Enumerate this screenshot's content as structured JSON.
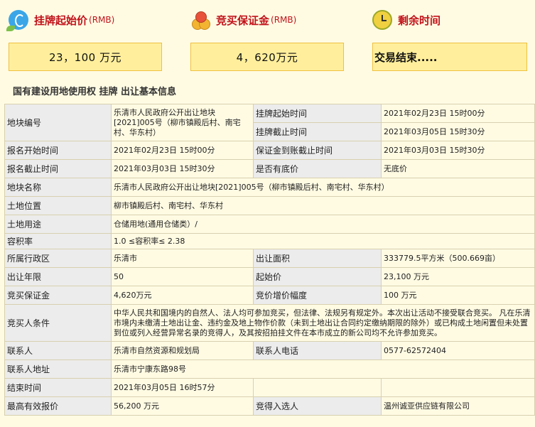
{
  "header": {
    "start_price": {
      "title": "挂牌起始价",
      "unit": "(RMB)",
      "icon": "money-icon",
      "value": "23，100  万元"
    },
    "deposit": {
      "title": "竞买保证金",
      "unit": "(RMB)",
      "icon": "coins-icon",
      "value": "4，620万元"
    },
    "remaining": {
      "title": "剩余时间",
      "icon": "clock-icon",
      "value": "交易结束....."
    }
  },
  "section_title": "国有建设用地使用权  挂牌  出让基本信息",
  "table": {
    "parcel_no_label": "地块编号",
    "parcel_no_value": "乐清市人民政府公开出让地块[2021]005号（柳市镇殿后村、南宅村、华东村）",
    "listing_start_label": "挂牌起始时间",
    "listing_start_value": "2021年02月23日 15时00分",
    "listing_end_label": "挂牌截止时间",
    "listing_end_value": "2021年03月05日 15时30分",
    "reg_start_label": "报名开始时间",
    "reg_start_value": "2021年02月23日 15时00分",
    "deposit_deadline_label": "保证金到账截止时间",
    "deposit_deadline_value": "2021年03月03日 15时30分",
    "reg_end_label": "报名截止时间",
    "reg_end_value": "2021年03月03日 15时30分",
    "reserve_label": "是否有底价",
    "reserve_value": "无底价",
    "parcel_name_label": "地块名称",
    "parcel_name_value": "乐清市人民政府公开出让地块[2021]005号（柳市镇殿后村、南宅村、华东村）",
    "location_label": "土地位置",
    "location_value": "柳市镇殿后村、南宅村、华东村",
    "usage_label": "土地用途",
    "usage_value": "仓储用地(通用仓储类）/",
    "far_label": "容积率",
    "far_value": "1.0 ≤容积率≤ 2.38",
    "district_label": "所属行政区",
    "district_value": "乐清市",
    "area_label": "出让面积",
    "area_value": "333779.5平方米（500.669亩）",
    "term_label": "出让年限",
    "term_value": "50",
    "start_price_label": "起始价",
    "start_price_value": "23,100 万元",
    "bid_deposit_label": "竞买保证金",
    "bid_deposit_value": "4,620万元",
    "increment_label": "竞价增价幅度",
    "increment_value": "100 万元",
    "conditions_label": "竞买人条件",
    "conditions_value": "中华人民共和国境内的自然人、法人均可参加竞买，但法律、法规另有规定外。本次出让活动不接受联合竞买。 凡在乐清市境内未缴清土地出让金、违约金及地上物作价款（未到土地出让合同约定缴纳期限的除外）或已构成土地闲置但未处置到位或列入经营异常名录的竞得人，及其按招拍挂文件在本市成立的新公司均不允许参加竞买。",
    "contact_label": "联系人",
    "contact_value": "乐清市自然资源和规划局",
    "phone_label": "联系人电话",
    "phone_value": "0577-62572404",
    "address_label": "联系人地址",
    "address_value": "乐清市宁康东路98号",
    "end_time_label": "结束时间",
    "end_time_value": "2021年03月05日 16时57分",
    "top_bid_label": "最高有效报价",
    "top_bid_value": "56,200 万元",
    "winner_label": "竞得入选人",
    "winner_value": "温州诚亚供应链有限公司"
  }
}
